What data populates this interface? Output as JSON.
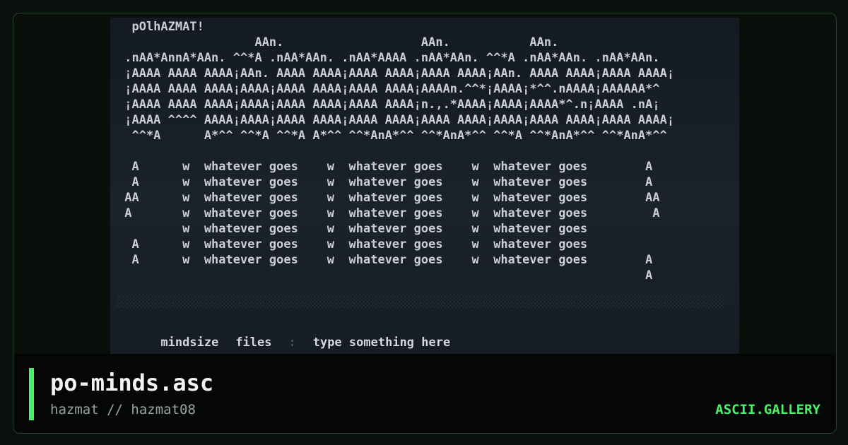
{
  "art": {
    "lines": [
      "  pOlhAZMAT!",
      "                   AAn.                   AAn.           AAn.",
      " .nAA*AnnA*AAn. ^^*A .nAA*AAn. .nAA*AAAA .nAA*AAn. ^^*A .nAA*AAn. .nAA*AAn.",
      " ¡AAAA AAAA AAAA¡AAn. AAAA AAAA¡AAAA AAAA¡AAAA AAAA¡AAn. AAAA AAAA¡AAAA AAAA¡",
      " ¡AAAA AAAA AAAA¡AAAA¡AAAA AAAA¡AAAA AAAA¡AAAAn.^^*¡AAAA¡*^^.nAAAA¡AAAAAA*^",
      " ¡AAAA AAAA AAAA¡AAAA¡AAAA AAAA¡AAAA AAAA¡n.,.*AAAA¡AAAA¡AAAA*^.n¡AAAA .nA¡",
      " ¡AAAA ^^^^ AAAA¡AAAA¡AAAA AAAA¡AAAA AAAA¡AAAA AAAA¡AAAA¡AAAA AAAA¡AAAA AAAA¡",
      "  ^^*A      A*^^ ^^*A ^^*A A*^^ ^^*AnA*^^ ^^*AnA*^^ ^^*A ^^*AnA*^^ ^^*AnA*^^",
      "",
      "  A      w  whatever goes    w  whatever goes    w  whatever goes        A",
      "  A      w  whatever goes    w  whatever goes    w  whatever goes        A",
      " AA      w  whatever goes    w  whatever goes    w  whatever goes        AA",
      " A       w  whatever goes    w  whatever goes    w  whatever goes         A",
      "         w  whatever goes    w  whatever goes    w  whatever goes",
      "  A      w  whatever goes    w  whatever goes    w  whatever goes",
      "  A      w  whatever goes    w  whatever goes    w  whatever goes        A",
      "                                                                         A"
    ]
  },
  "statusbar": {
    "mindsize_label": "mindsize",
    "files_label": "files",
    "input_placeholder": "type something here"
  },
  "footer": {
    "title": "po-minds.asc",
    "byline": "hazmat // hazmat08",
    "brand": "ASCII.GALLERY"
  },
  "colors": {
    "accent": "#4cf06a",
    "background": "#0a0f0c"
  }
}
